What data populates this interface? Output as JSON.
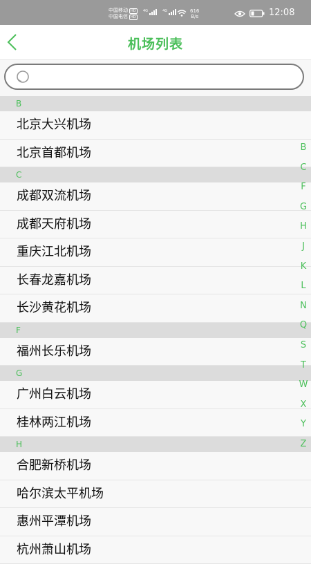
{
  "status_bar": {
    "carrier1": "中国移动",
    "carrier2": "中国电信",
    "hd_badge": "HD",
    "network_type": "4G",
    "speed_value": "616",
    "speed_unit": "B/s",
    "time": "12:08"
  },
  "nav": {
    "title": "机场列表"
  },
  "search": {
    "placeholder": "",
    "value": ""
  },
  "sections": [
    {
      "header": "B",
      "items": [
        "北京大兴机场",
        "北京首都机场"
      ]
    },
    {
      "header": "C",
      "items": [
        "成都双流机场",
        "成都天府机场",
        "重庆江北机场",
        "长春龙嘉机场",
        "长沙黄花机场"
      ]
    },
    {
      "header": "F",
      "items": [
        "福州长乐机场"
      ]
    },
    {
      "header": "G",
      "items": [
        "广州白云机场",
        "桂林两江机场"
      ]
    },
    {
      "header": "H",
      "items": [
        "合肥新桥机场",
        "哈尔滨太平机场",
        "惠州平潭机场",
        "杭州萧山机场"
      ]
    }
  ],
  "index_letters": [
    "B",
    "C",
    "F",
    "G",
    "H",
    "J",
    "K",
    "L",
    "N",
    "Q",
    "S",
    "T",
    "W",
    "X",
    "Y",
    "Z"
  ],
  "colors": {
    "accent": "#4bbf5a",
    "status_bar": "#9a9a9a",
    "section_bg": "#dcdcdc"
  }
}
